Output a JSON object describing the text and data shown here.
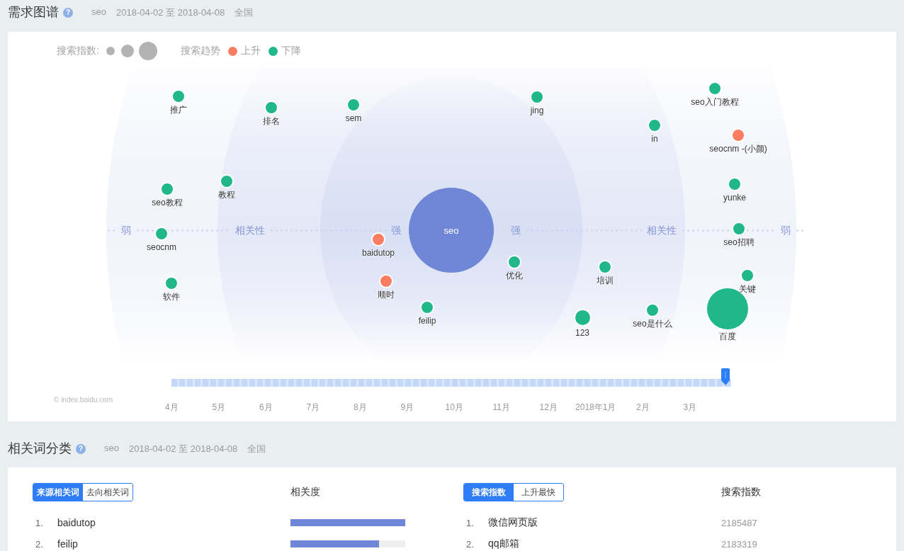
{
  "demand_map": {
    "title": "需求图谱",
    "help": "?",
    "meta": [
      "seo",
      "2018-04-02 至 2018-04-08",
      "全国"
    ],
    "legend": {
      "size_label": "搜索指数:",
      "trend_label": "搜索趋势",
      "trends": [
        {
          "label": "上升",
          "color": "#fa7c61"
        },
        {
          "label": "下降",
          "color": "#20b78a"
        }
      ]
    },
    "axis_labels": [
      "弱",
      "相关性",
      "强",
      "强",
      "相关性",
      "弱"
    ],
    "center": {
      "label": "seo"
    },
    "keywords": [
      {
        "label": "推广",
        "color": "#20b78a",
        "kind": "small"
      },
      {
        "label": "排名",
        "color": "#20b78a",
        "kind": "small"
      },
      {
        "label": "sem",
        "color": "#20b78a",
        "kind": "small"
      },
      {
        "label": "jing",
        "color": "#20b78a",
        "kind": "small"
      },
      {
        "label": "seo入门教程",
        "color": "#20b78a",
        "kind": "small"
      },
      {
        "label": "in",
        "color": "#20b78a",
        "kind": "small"
      },
      {
        "label": "seocnm -(小颜)",
        "color": "#fa7c61",
        "kind": "small"
      },
      {
        "label": "seo教程",
        "color": "#20b78a",
        "kind": "small"
      },
      {
        "label": "教程",
        "color": "#20b78a",
        "kind": "small"
      },
      {
        "label": "yunke",
        "color": "#20b78a",
        "kind": "small"
      },
      {
        "label": "seocnm",
        "color": "#20b78a",
        "kind": "small"
      },
      {
        "label": "seo招聘",
        "color": "#20b78a",
        "kind": "small"
      },
      {
        "label": "baidutop",
        "color": "#fa7c61",
        "kind": "small"
      },
      {
        "label": "优化",
        "color": "#20b78a",
        "kind": "small"
      },
      {
        "label": "培训",
        "color": "#20b78a",
        "kind": "small"
      },
      {
        "label": "关键",
        "color": "#20b78a",
        "kind": "small"
      },
      {
        "label": "软件",
        "color": "#20b78a",
        "kind": "small"
      },
      {
        "label": "顺时",
        "color": "#fa7c61",
        "kind": "small"
      },
      {
        "label": "feilip",
        "color": "#20b78a",
        "kind": "small"
      },
      {
        "label": "123",
        "color": "#20b78a",
        "kind": "medium"
      },
      {
        "label": "seo是什么",
        "color": "#20b78a",
        "kind": "small"
      },
      {
        "label": "百度",
        "color": "#20b78a",
        "kind": "large"
      }
    ],
    "source": "© index.baidu.com",
    "timeline": {
      "level": 0.99,
      "months": [
        "4月",
        "5月",
        "6月",
        "7月",
        "8月",
        "9月",
        "10月",
        "11月",
        "12月",
        "2018年1月",
        "2月",
        "3月"
      ]
    }
  },
  "related_words": {
    "title": "相关词分类",
    "help": "?",
    "meta": [
      "seo",
      "2018-04-02 至 2018-04-08",
      "全国"
    ],
    "relevance_panel": {
      "tabs": [
        {
          "label": "来源相关词",
          "selected": true
        },
        {
          "label": "去向相关词",
          "selected": false
        }
      ],
      "column": "相关度",
      "rows": [
        {
          "rank": "1.",
          "word": "baidutop",
          "level": 1.0
        },
        {
          "rank": "2.",
          "word": "feilip",
          "level": 0.77
        }
      ]
    },
    "search_panel": {
      "tabs": [
        {
          "label": "搜索指数",
          "selected": true
        },
        {
          "label": "上升最快",
          "selected": false
        }
      ],
      "column": "搜索指数",
      "rows": [
        {
          "rank": "1.",
          "word": "微信网页版",
          "value": "2185487"
        },
        {
          "rank": "2.",
          "word": "qq邮箱",
          "value": "2183319"
        }
      ]
    }
  }
}
